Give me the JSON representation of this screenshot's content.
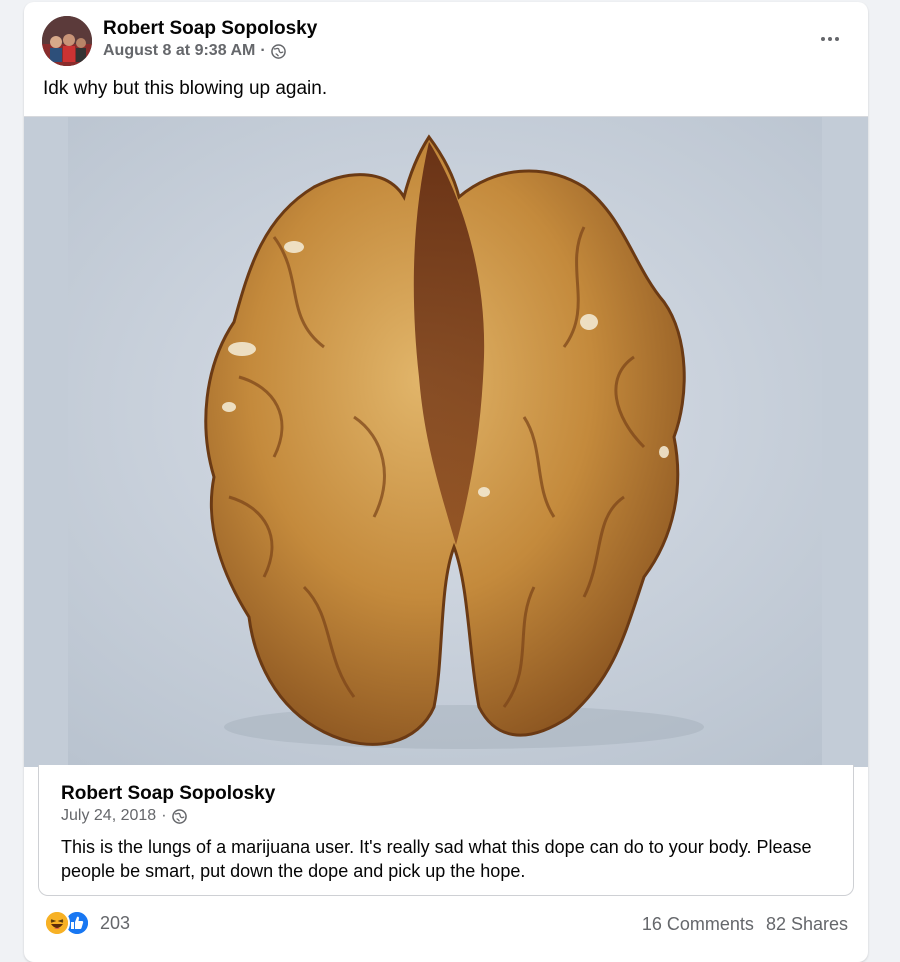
{
  "post": {
    "author": "Robert Soap Sopolosky",
    "timestamp": "August 8 at 9:38 AM",
    "separator": "·",
    "audience_icon": "globe-icon",
    "caption": "Idk why but this blowing up again.",
    "more_icon": "more-options-icon"
  },
  "shared_post": {
    "author": "Robert Soap Sopolosky",
    "timestamp": "July 24, 2018",
    "separator": "·",
    "audience_icon": "globe-icon",
    "text": "This is the lungs of a marijuana user. It's really sad what this dope can do to your body. Please people be smart, put down the dope and pick up the hope."
  },
  "footer": {
    "reaction_icons": [
      "haha-reaction-icon",
      "like-reaction-icon"
    ],
    "reaction_count": "203",
    "comments": "16 Comments",
    "shares": "82 Shares"
  },
  "colors": {
    "background": "#f0f2f5",
    "card": "#ffffff",
    "secondary_text": "#65676b",
    "like_blue": "#1877f2",
    "haha_yellow": "#f7b125"
  }
}
